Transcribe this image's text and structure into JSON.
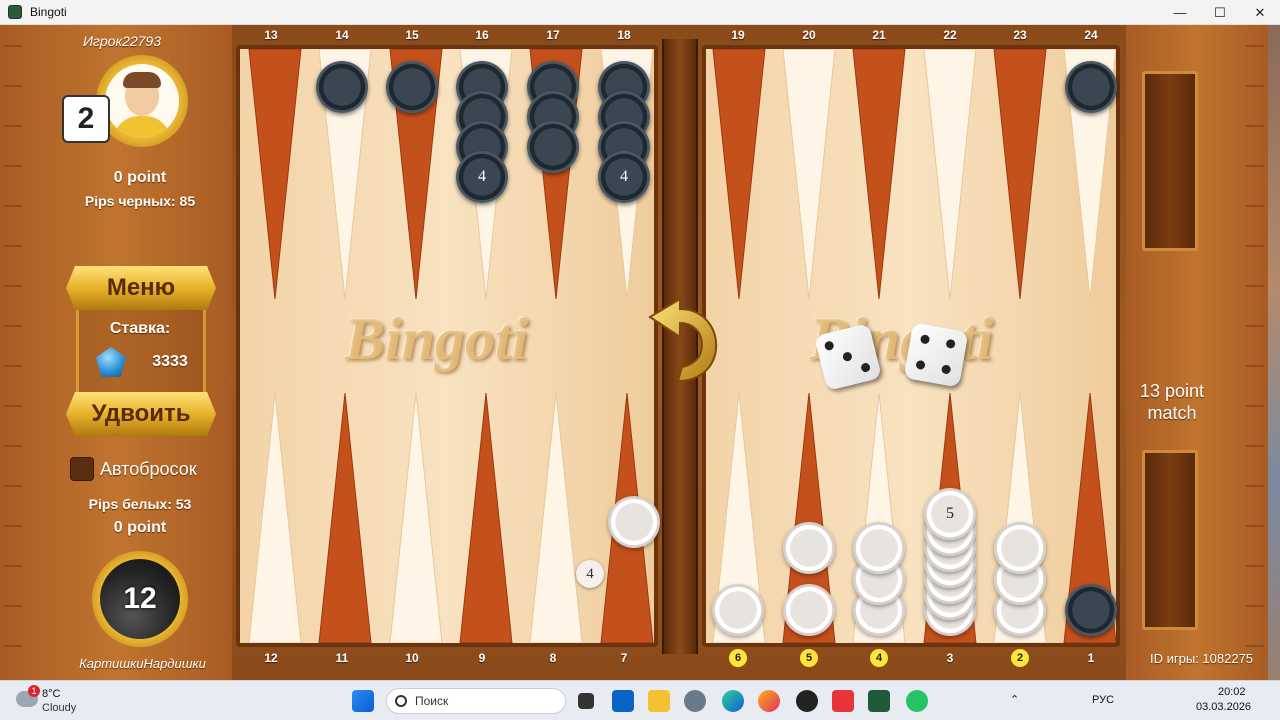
{
  "window": {
    "title": "Bingoti",
    "minimize": "—",
    "maximize": "☐",
    "close": "✕"
  },
  "top_player": {
    "name": "Игрок22793",
    "score": "2",
    "points": "0 point",
    "pips": "Pips черных: 85"
  },
  "controls": {
    "menu": "Меню",
    "stake_label": "Ставка:",
    "stake_value": "3333",
    "double": "Удвоить",
    "autoroll": "Автобросок"
  },
  "bottom_player": {
    "name": "КартишкиНардишки",
    "pips": "Pips белых: 53",
    "points": "0 point",
    "timer": "12"
  },
  "board": {
    "logo": "Bingoti",
    "top_numbers": [
      "13",
      "14",
      "15",
      "16",
      "17",
      "18",
      "19",
      "20",
      "21",
      "22",
      "23",
      "24"
    ],
    "bottom_numbers": [
      "12",
      "11",
      "10",
      "9",
      "8",
      "7",
      "6",
      "5",
      "4",
      "3",
      "2",
      "1"
    ],
    "highlighted_points": [
      "6",
      "5",
      "4",
      "2"
    ],
    "stack_labels": {
      "p16": "4",
      "p18": "4",
      "p3": "5",
      "bar_badge": "4"
    },
    "dice": [
      3,
      4
    ],
    "colors": {
      "black_checker": "#2b3640",
      "white_checker": "#f2eeea",
      "dark_triangle": "#c4501c",
      "light_triangle": "#fff5e6"
    }
  },
  "match": {
    "label_line1": "13 point",
    "label_line2": "match",
    "game_id": "ID игры: 1082275"
  },
  "taskbar": {
    "weather_temp": "8°C",
    "weather_desc": "Cloudy",
    "weather_badge": "1",
    "search": "Поиск",
    "lang": "РУС",
    "time": "20:02",
    "date": "03.03.2026"
  }
}
